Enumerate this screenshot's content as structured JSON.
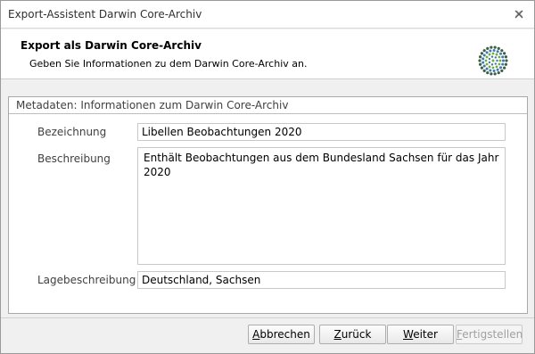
{
  "window": {
    "title": "Export-Assistent Darwin Core-Archiv"
  },
  "header": {
    "title": "Export als Darwin Core-Archiv",
    "subtitle": "Geben Sie Informationen zu dem Darwin Core-Archiv an.",
    "logo_icon": "gbif-dot-logo"
  },
  "metadata_group": {
    "title": "Metadaten: Informationen zum Darwin Core-Archiv",
    "fields": {
      "bezeichnung": {
        "label": "Bezeichnung",
        "value": "Libellen Beobachtungen 2020"
      },
      "beschreibung": {
        "label": "Beschreibung",
        "value": "Enthält Beobachtungen aus dem Bundesland Sachsen für das Jahr 2020"
      },
      "lagebeschreibung": {
        "label": "Lagebeschreibung",
        "value": "Deutschland, Sachsen"
      }
    }
  },
  "footer": {
    "buttons": {
      "abbrechen": {
        "label": "Abbrechen",
        "access_key": "A",
        "rest": "bbrechen",
        "enabled": true
      },
      "zurueck": {
        "label": "Zurück",
        "access_key": "Z",
        "rest": "urück",
        "enabled": true
      },
      "weiter": {
        "label": "Weiter",
        "access_key": "W",
        "rest": "eiter",
        "enabled": true
      },
      "fertigstellen": {
        "label": "Fertigstellen",
        "access_key": "F",
        "rest": "ertigstellen",
        "enabled": false
      }
    }
  },
  "colors": {
    "logo_dark": "#3b5f45",
    "logo_blue": "#3c78b5",
    "logo_green": "#6fae3c"
  }
}
